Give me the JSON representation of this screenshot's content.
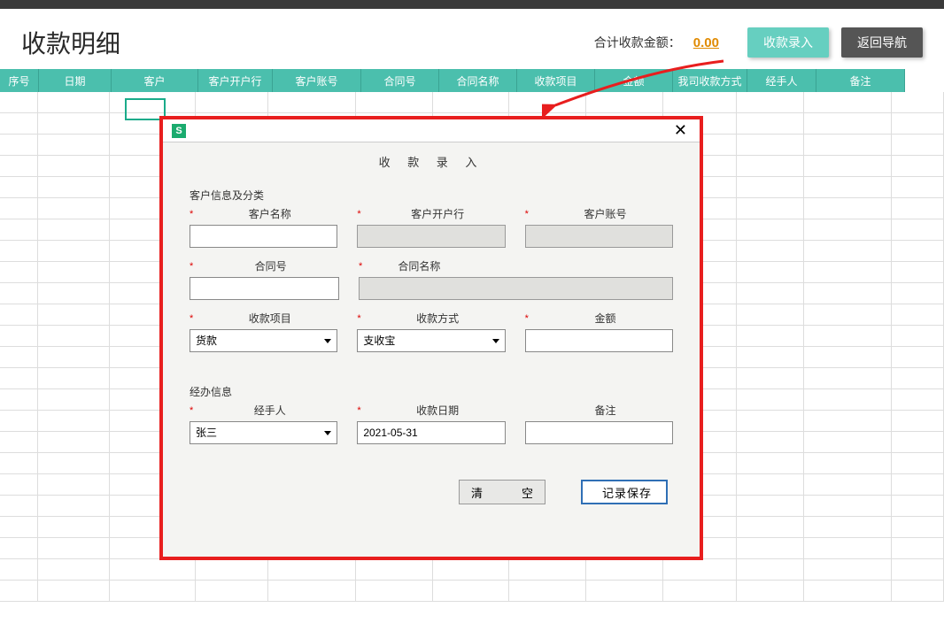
{
  "header": {
    "title": "收款明细",
    "total_label": "合计收款金额：",
    "total_amount": "0.00",
    "entry_button": "收款录入",
    "back_button": "返回导航"
  },
  "columns": {
    "serial": "序号",
    "date": "日期",
    "customer": "客户",
    "bank": "客户开户行",
    "account": "客户账号",
    "contract": "合同号",
    "contract_name": "合同名称",
    "item": "收款项目",
    "amount": "金额",
    "method": "我司收款方式",
    "handler": "经手人",
    "remark": "备注"
  },
  "modal": {
    "icon_letter": "S",
    "title": "收 款 录 入",
    "section1": "客户信息及分类",
    "fields": {
      "customer_name": {
        "label": "客户名称",
        "value": ""
      },
      "customer_bank": {
        "label": "客户开户行",
        "value": ""
      },
      "customer_account": {
        "label": "客户账号",
        "value": ""
      },
      "contract_no": {
        "label": "合同号",
        "value": ""
      },
      "contract_name": {
        "label": "合同名称",
        "value": ""
      },
      "item": {
        "label": "收款项目",
        "value": "货款"
      },
      "method": {
        "label": "收款方式",
        "value": "支收宝"
      },
      "amount": {
        "label": "金额",
        "value": ""
      }
    },
    "section2": "经办信息",
    "fields2": {
      "handler": {
        "label": "经手人",
        "value": "张三"
      },
      "date": {
        "label": "收款日期",
        "value": "2021-05-31"
      },
      "remark": {
        "label": "备注",
        "value": ""
      }
    },
    "clear_btn": "清　　空",
    "save_btn": "记录保存"
  }
}
